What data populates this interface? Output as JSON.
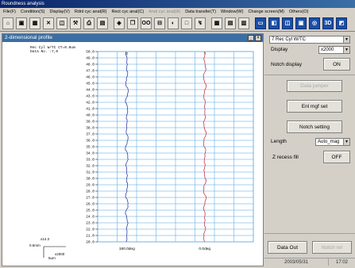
{
  "window": {
    "title": "Roundness analysis"
  },
  "menu": [
    {
      "label": "File(F)",
      "enabled": true
    },
    {
      "label": "Condition(S)",
      "enabled": true
    },
    {
      "label": "Display(V)",
      "enabled": true
    },
    {
      "label": "Rdnl cyc anal(R)",
      "enabled": true
    },
    {
      "label": "Rect cyc anal(C)",
      "enabled": true
    },
    {
      "label": "Anal cyc anal(A)",
      "enabled": false
    },
    {
      "label": "Data transfer(T)",
      "enabled": true
    },
    {
      "label": "Window(W)",
      "enabled": true
    },
    {
      "label": "Change screen(M)",
      "enabled": true
    },
    {
      "label": "Others(O)",
      "enabled": true
    }
  ],
  "toolbar": {
    "icons": [
      "open-folder-icon",
      "save-icon",
      "chart-icon",
      "cross-icon",
      "print-preview-icon",
      "tool-icon",
      "print-icon",
      "image-icon",
      "filter-icon",
      "copy-icon",
      "oo-icon",
      "measure-icon",
      "cylinder-icon",
      "blank-icon",
      "stylus-icon",
      "grid-icon",
      "table-icon",
      "plot-icon",
      "layout1-icon",
      "layout2-icon",
      "layout3-icon",
      "layout4-icon",
      "layout5-icon",
      "3d-icon",
      "layout6-icon"
    ],
    "text": {
      "oo-icon": "OO",
      "3d-icon": "3D"
    }
  },
  "chart_window": {
    "title": "2-dimensional profile",
    "close": "×",
    "minimize": "_"
  },
  "plot": {
    "header_line1": "Rec Cyl W/TC CT=0.0um",
    "header_line2": "Data No. :7,0",
    "top_labels": [
      "0",
      "7"
    ],
    "bottom_labels": [
      "180.0deg",
      "0.0deg"
    ],
    "scale_x": "x14.3",
    "scale_h": "0.5mm",
    "scale_v": "5um",
    "scale_mag": "x2000"
  },
  "chart_data": {
    "type": "line",
    "y_tick_labels": [
      "50.0",
      "49.0",
      "48.0",
      "47.0",
      "46.0",
      "45.0",
      "44.0",
      "43.0",
      "42.0",
      "41.0",
      "40.0",
      "39.0",
      "38.0",
      "37.0",
      "36.0",
      "35.0",
      "34.0",
      "33.0",
      "32.0",
      "31.0",
      "30.0",
      "29.0",
      "28.0",
      "27.0",
      "26.0",
      "25.0",
      "24.0",
      "23.0",
      "22.0",
      "21.0",
      "20.0"
    ],
    "series": [
      {
        "name": "180.0deg",
        "color": "#1a2a9a"
      },
      {
        "name": "0.0deg",
        "color": "#c0203a"
      }
    ]
  },
  "right_panel": {
    "profile_select": "7 Rec Cyl W/TC",
    "display_label": "Display",
    "display_select": "x2000",
    "notch_display_label": "Notch display",
    "notch_display_btn": "ON",
    "data_jumper_btn": "Data jumper",
    "enl_mgf_set_btn": "Enl mgf set",
    "notch_setting_btn": "Notch setting",
    "length_label": "Length",
    "length_select": "Auto_mag",
    "z_recess_fill_label": "Z recess fill",
    "z_recess_fill_btn": "OFF",
    "data_out_btn": "Data Out",
    "notch_ret_btn": "Notch ret",
    "date": "2003/05/31",
    "time": "17:02"
  },
  "colors": {
    "title_blue": "#3a6ea5",
    "grid_blue": "#4aa0e0",
    "trace_left": "#1a2a9a",
    "trace_right": "#c0203a"
  }
}
